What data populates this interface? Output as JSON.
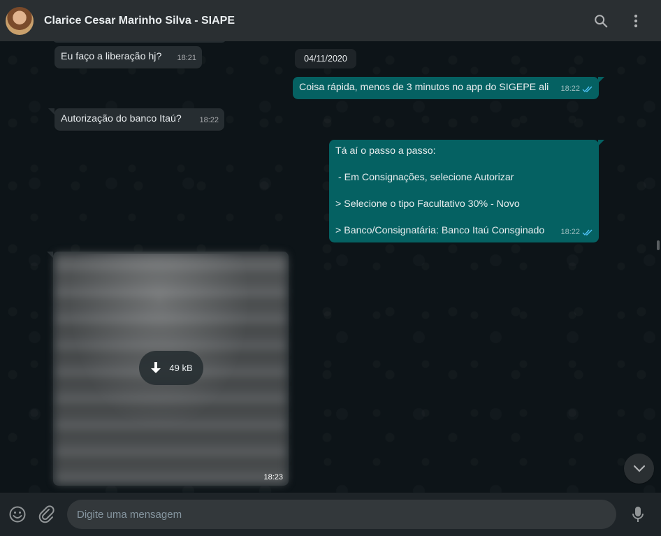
{
  "header": {
    "contact_name": "Clarice Cesar Marinho Silva - SIAPE",
    "avatar_icon": "contact-avatar",
    "search_icon": "search-icon",
    "menu_icon": "kebab-menu-icon"
  },
  "chat": {
    "date_chip": "04/11/2020",
    "messages": [
      {
        "direction": "in",
        "text": "Eu faço a liberação hj?",
        "time": "18:21"
      },
      {
        "direction": "out",
        "text": "Coisa rápida, menos de 3 minutos no app do SIGEPE ali",
        "time": "18:22",
        "status": "read"
      },
      {
        "direction": "in",
        "text": "Autorização do banco Itaú?",
        "time": "18:22"
      },
      {
        "direction": "out",
        "lines": [
          "Tá aí o passo a passo:",
          " - Em Consignações, selecione Autorizar",
          "> Selecione o tipo Facultativo 30% - Novo",
          "> Banco/Consignatária: Banco Itaú Consginado"
        ],
        "time": "18:22",
        "status": "read"
      },
      {
        "direction": "in",
        "type": "image",
        "size": "49 kB",
        "time": "18:23"
      }
    ]
  },
  "footer": {
    "emoji_icon": "emoji-icon",
    "attach_icon": "paperclip-icon",
    "placeholder": "Digite uma mensagem",
    "mic_icon": "microphone-icon"
  },
  "colors": {
    "header_bg": "#2a2f32",
    "chat_bg": "#0d1418",
    "incoming_bubble": "#262d31",
    "outgoing_bubble": "#056162",
    "read_ticks": "#4fc3f7"
  }
}
